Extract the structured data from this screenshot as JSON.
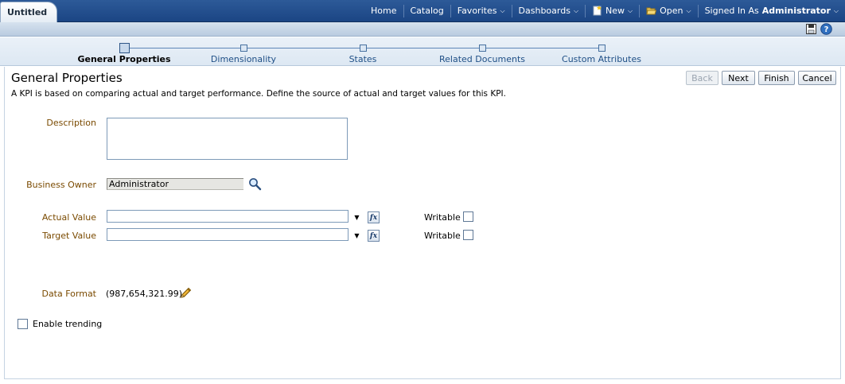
{
  "document_tab": {
    "title": "Untitled"
  },
  "nav": {
    "home": "Home",
    "catalog": "Catalog",
    "favorites": "Favorites",
    "dashboards": "Dashboards",
    "new": "New",
    "open": "Open",
    "signed_in_prefix": "Signed In As",
    "user": "Administrator"
  },
  "train": {
    "steps": [
      {
        "label": "General Properties",
        "current": true
      },
      {
        "label": "Dimensionality",
        "current": false
      },
      {
        "label": "States",
        "current": false
      },
      {
        "label": "Related Documents",
        "current": false
      },
      {
        "label": "Custom Attributes",
        "current": false
      }
    ]
  },
  "page": {
    "title": "General Properties",
    "description": "A KPI is based on comparing actual and target performance. Define the source of actual and target values for this KPI."
  },
  "buttons": {
    "back": "Back",
    "next": "Next",
    "finish": "Finish",
    "cancel": "Cancel"
  },
  "form": {
    "description_label": "Description",
    "description_value": "",
    "business_owner_label": "Business Owner",
    "business_owner_value": "Administrator",
    "actual_value_label": "Actual Value",
    "actual_value": "",
    "target_value_label": "Target Value",
    "target_value": "",
    "writable_label": "Writable",
    "data_format_label": "Data Format",
    "data_format_value": "(987,654,321.99)",
    "enable_trending_label": "Enable trending"
  },
  "colors": {
    "header_blue": "#1b4584",
    "label_brown": "#7a4a00",
    "link_blue": "#1f4f86"
  },
  "icons": {
    "search": "search-icon",
    "formula": "fx-icon",
    "edit": "pencil-icon",
    "save": "save-icon",
    "help": "help-icon"
  }
}
